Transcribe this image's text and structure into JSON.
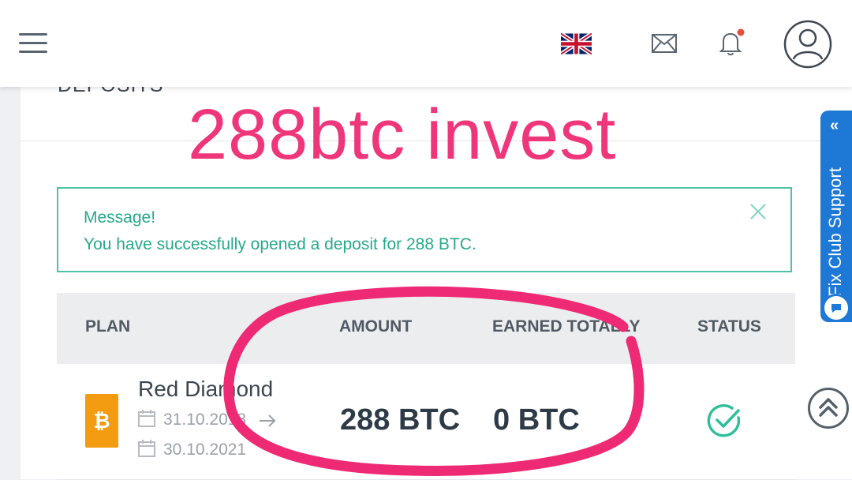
{
  "header": {
    "menu_icon": "hamburger-menu-icon",
    "language_icon": "uk-flag-icon",
    "mail_icon": "envelope-icon",
    "bell_icon": "bell-icon",
    "profile_icon": "user-avatar-icon",
    "notification_dot_color": "#e74c3c"
  },
  "section": {
    "title": "DEPOSITS"
  },
  "overlay": {
    "title": "288btc invest",
    "color": "#f0367a"
  },
  "alert": {
    "title": "Message!",
    "text": "You have successfully opened a deposit for 288 BTC.",
    "close_icon": "close-icon",
    "color": "#27a98b"
  },
  "table": {
    "headers": {
      "plan": "PLAN",
      "amount": "AMOUNT",
      "earned": "EARNED TOTALLY",
      "status": "STATUS"
    },
    "rows": [
      {
        "plan_name": "Red Diamond",
        "currency_symbol": "₿",
        "start_date": "31.10.2018",
        "end_date": "30.10.2021",
        "amount": "288 BTC",
        "earned": "0 BTC",
        "status_icon": "check-circle-icon"
      }
    ]
  },
  "support": {
    "label": "Fix Club Support",
    "chevron": "«",
    "chat_icon": "chat-bubble-icon"
  },
  "scroll_top_icon": "double-chevron-up-icon"
}
